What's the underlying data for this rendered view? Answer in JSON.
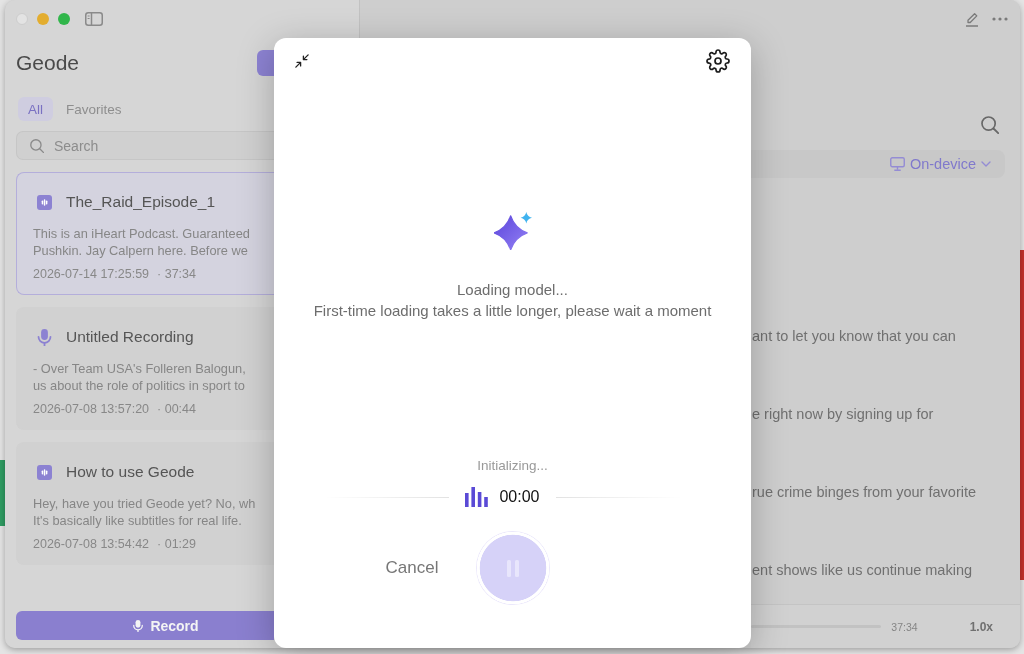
{
  "sidebar": {
    "title": "Geode",
    "tabs": [
      {
        "label": "All",
        "selected": true
      },
      {
        "label": "Favorites",
        "selected": false
      }
    ],
    "search": {
      "placeholder": "Search"
    },
    "recordings": [
      {
        "kind": "file",
        "title": "The_Raid_Episode_1",
        "preview": [
          "This is an iHeart Podcast. Guaranteed",
          "Pushkin. Jay Calpern here. Before we"
        ],
        "date": "2026-07-14 17:25:59",
        "duration": "· 37:34",
        "selected": true
      },
      {
        "kind": "voice",
        "title": "Untitled Recording",
        "preview": [
          "- Over Team USA's Folleren Balogun,",
          "us about the role of politics in sport to"
        ],
        "date": "2026-07-08 13:57:20",
        "duration": "· 00:44",
        "selected": false
      },
      {
        "kind": "file",
        "title": "How to use Geode",
        "preview": [
          "Hey, have you tried Geode yet? No, wh",
          "It's basically like subtitles for real life."
        ],
        "date": "2026-07-08 13:54:42",
        "duration": "· 01:29",
        "selected": false
      }
    ],
    "record_button": {
      "label": "Record"
    }
  },
  "main": {
    "model_selector": {
      "label": "On-device"
    },
    "transcript": [
      "ant to let you know that you can",
      "e right now by signing up for",
      "rue crime binges from your favorite",
      "ent shows like us continue making"
    ],
    "player": {
      "duration": "37:34",
      "speed": "1.0x"
    }
  },
  "dialog": {
    "message": "Loading model...",
    "hint": "First-time loading takes a little longer, please wait a moment",
    "status": "Initializing...",
    "timer": "00:00",
    "cancel_button": {
      "label": "Cancel"
    },
    "pause_button": {
      "disabled": true
    }
  }
}
